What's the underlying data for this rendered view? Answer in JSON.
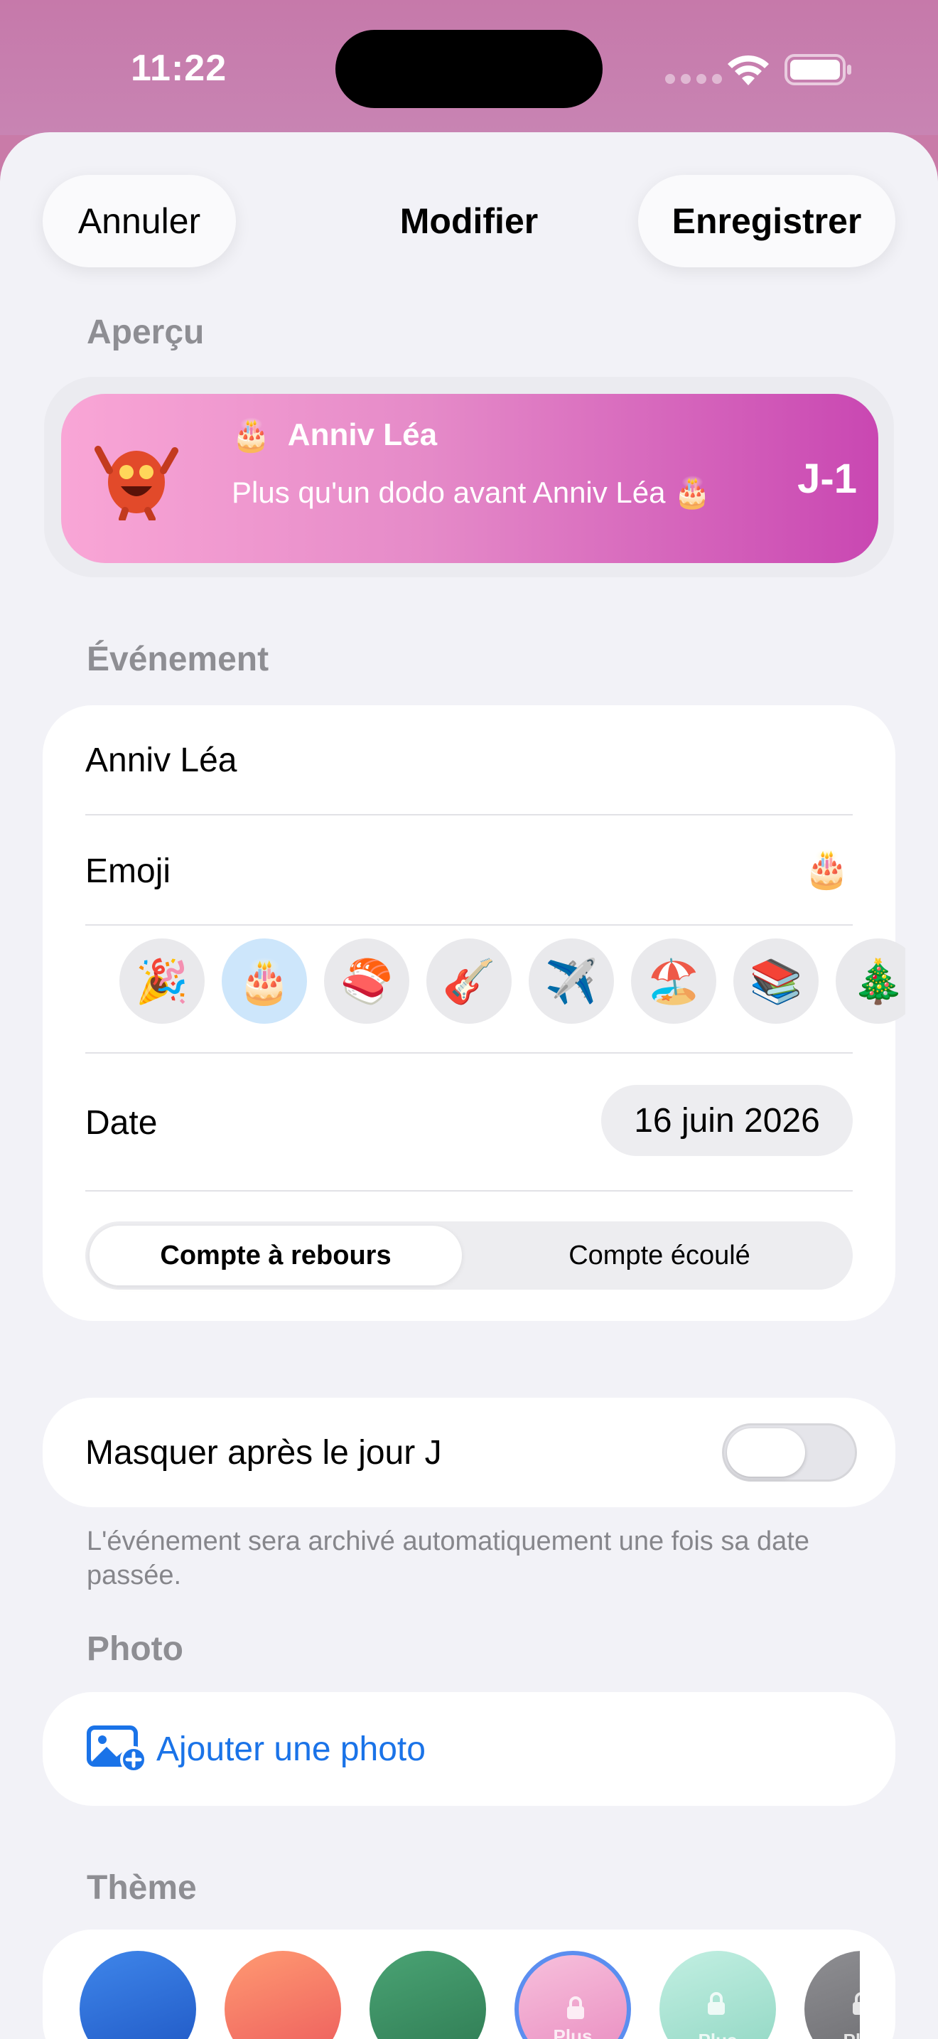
{
  "status": {
    "time": "11:22"
  },
  "nav": {
    "cancel": "Annuler",
    "title": "Modifier",
    "save": "Enregistrer"
  },
  "preview": {
    "section": "Aperçu",
    "emoji": "🎂",
    "title": "Anniv Léa",
    "subtitle": "Plus qu'un dodo avant Anniv Léa 🎂",
    "count": "J-1"
  },
  "event": {
    "section": "Événement",
    "name_value": "Anniv Léa",
    "emoji_label": "Emoji",
    "emoji_value": "🎂",
    "emoji_options": [
      "🎉",
      "🎂",
      "🍣",
      "🎸",
      "✈️",
      "🏖️",
      "📚",
      "🎄"
    ],
    "selected_emoji_index": 1,
    "date_label": "Date",
    "date_value": "16 juin 2026",
    "mode_options": [
      "Compte à rebours",
      "Compte écoulé"
    ],
    "mode_selected": "Compte à rebours"
  },
  "hide": {
    "label": "Masquer après le jour J",
    "enabled": false,
    "footnote": "L'événement sera archivé automatiquement une fois sa date passée."
  },
  "photo": {
    "section": "Photo",
    "add_label": "Ajouter une photo"
  },
  "theme": {
    "section": "Thème",
    "locked_label": "Plus",
    "colors": [
      "#2f6fd8",
      "#f2715e",
      "#3a8a5c",
      "#f2a9cf",
      "#a9e1d2",
      "#7a7a7e"
    ]
  },
  "colors": {
    "accent": "#1a73e8",
    "preview_gradient_start": "#f9a6d6",
    "preview_gradient_end": "#c947b2"
  }
}
